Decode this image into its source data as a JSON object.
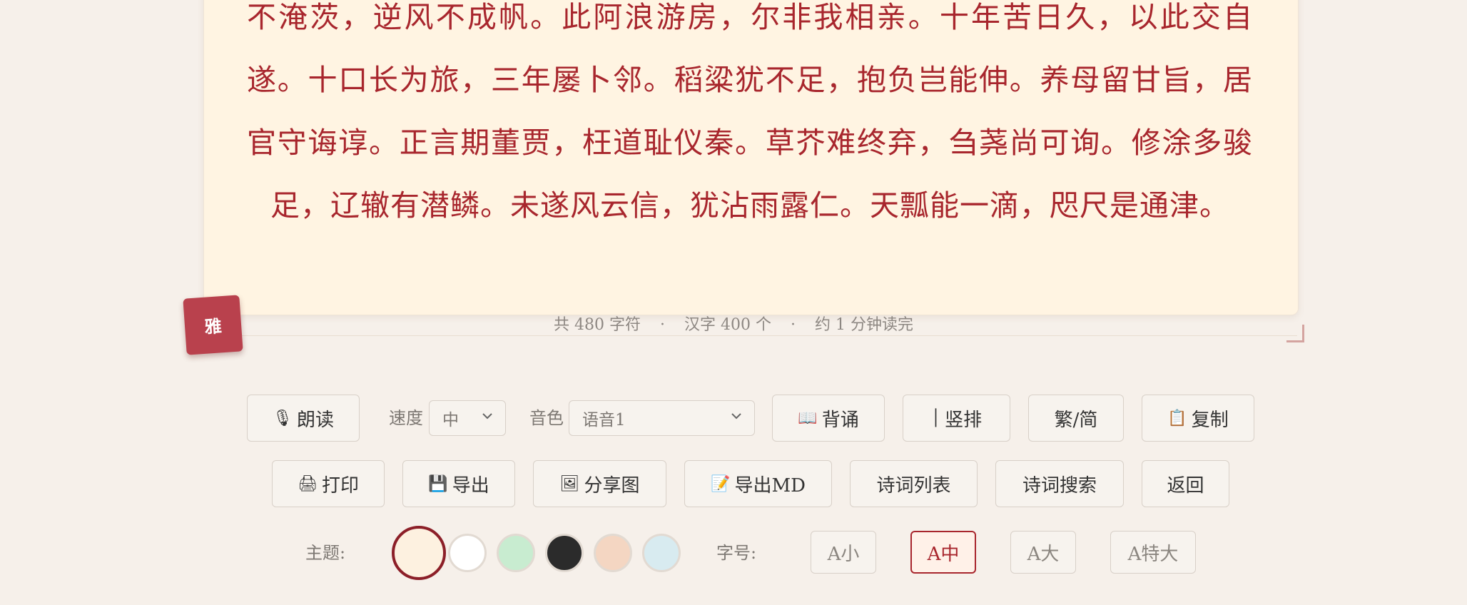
{
  "poem_text": "不淹茨，逆风不成帆。此阿浪游房，尔非我相亲。十年苦日久，以此交自遂。十口长为旅，三年屡卜邻。稻粱犹不足，抱负岂能伸。养母留甘旨，居官守诲谆。正言期董贾，枉道耻仪秦。草芥难终弃，刍荛尚可询。修涂多骏足，辽辙有潜鳞。未遂风云信，犹沾雨露仁。天瓢能一滴，咫尺是通津。",
  "stats": {
    "chars": "共 480 字符",
    "hanzi": "汉字 400 个",
    "time": "约 1 分钟读完",
    "separator": "·"
  },
  "seal_text": "雅",
  "toolbar_row1": {
    "read_icon": "🎙",
    "read_label": "朗读",
    "speed_label": "速度",
    "speed_value": "中",
    "voice_label": "音色",
    "voice_value": "语音1",
    "recite_icon": "📖",
    "recite_label": "背诵",
    "vertical_icon": "│",
    "vertical_label": "竖排",
    "trad_simp_label": "繁/简",
    "copy_icon": "📋",
    "copy_label": "复制"
  },
  "toolbar_row2": {
    "print_icon": "🖨",
    "print_label": "打印",
    "export_icon": "💾",
    "export_label": "导出",
    "share_icon": "🖼",
    "share_label": "分享图",
    "export_md_icon": "📝",
    "export_md_label": "导出MD",
    "poem_list_label": "诗词列表",
    "poem_search_label": "诗词搜索",
    "back_label": "返回"
  },
  "theme": {
    "label": "主题:",
    "swatches": [
      "#fdf1e0",
      "#ffffff",
      "#c8ecd0",
      "#2b2b2b",
      "#f4d6c2",
      "#d8ebf0"
    ],
    "selected_index": 0
  },
  "font_size": {
    "label": "字号:",
    "options": [
      "A小",
      "A中",
      "A大",
      "A特大"
    ],
    "selected": "A中"
  },
  "colors": {
    "accent": "#a8262d",
    "seal": "#b9414d",
    "paper": "#fff4e2",
    "background": "#f6f0ea"
  }
}
